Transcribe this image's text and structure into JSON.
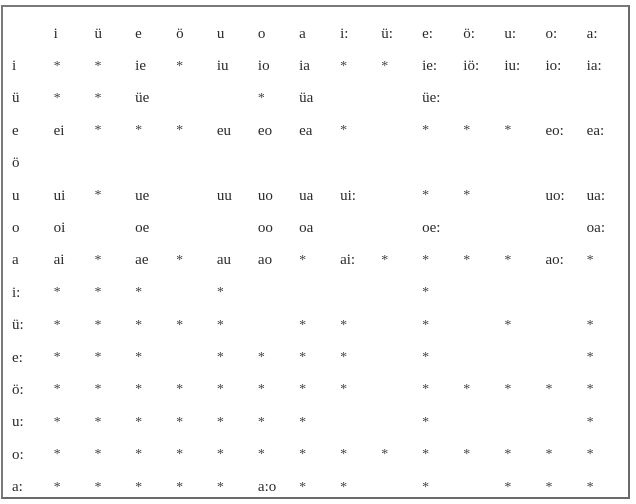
{
  "table": {
    "header": [
      "",
      "i",
      "ü",
      "e",
      "ö",
      "u",
      "o",
      "a",
      "i:",
      "ü:",
      "e:",
      "ö:",
      "u:",
      "o:",
      "a:"
    ],
    "rows": [
      {
        "label": "i",
        "cells": [
          "*",
          "*",
          "ie",
          "*",
          "iu",
          "io",
          "ia",
          "*",
          "*",
          "ie:",
          "iö:",
          "iu:",
          "io:",
          "ia:"
        ]
      },
      {
        "label": "ü",
        "cells": [
          "*",
          "*",
          "üe",
          "",
          "",
          "*",
          "üa",
          "",
          "",
          "üe:",
          "",
          "",
          "",
          ""
        ]
      },
      {
        "label": "e",
        "cells": [
          "ei",
          "*",
          "*",
          "*",
          "eu",
          "eo",
          "ea",
          "*",
          "",
          "*",
          "*",
          "*",
          "eo:",
          "ea:"
        ]
      },
      {
        "label": "ö",
        "cells": [
          "",
          "",
          "",
          "",
          "",
          "",
          "",
          "",
          "",
          "",
          "",
          "",
          "",
          ""
        ]
      },
      {
        "label": "u",
        "cells": [
          "ui",
          "*",
          "ue",
          "",
          "uu",
          "uo",
          "ua",
          "ui:",
          "",
          "*",
          "*",
          "",
          "uo:",
          "ua:"
        ]
      },
      {
        "label": "o",
        "cells": [
          "oi",
          "",
          "oe",
          "",
          "",
          "oo",
          "oa",
          "",
          "",
          "oe:",
          "",
          "",
          "",
          "oa:"
        ]
      },
      {
        "label": "a",
        "cells": [
          "ai",
          "*",
          "ae",
          "*",
          "au",
          "ao",
          "*",
          "ai:",
          "*",
          "*",
          "*",
          "*",
          "ao:",
          "*"
        ]
      },
      {
        "label": "i:",
        "cells": [
          "*",
          "*",
          "*",
          "",
          "*",
          "",
          "",
          "",
          "",
          "*",
          "",
          "",
          "",
          ""
        ]
      },
      {
        "label": "ü:",
        "cells": [
          "*",
          "*",
          "*",
          "*",
          "*",
          "",
          "*",
          "*",
          "",
          "*",
          "",
          "*",
          "",
          "*"
        ]
      },
      {
        "label": "e:",
        "cells": [
          "*",
          "*",
          "*",
          "",
          "*",
          "*",
          "*",
          "*",
          "",
          "*",
          "",
          "",
          "",
          "*"
        ]
      },
      {
        "label": "ö:",
        "cells": [
          "*",
          "*",
          "*",
          "*",
          "*",
          "*",
          "*",
          "*",
          "",
          "*",
          "*",
          "*",
          "*",
          "*"
        ]
      },
      {
        "label": "u:",
        "cells": [
          "*",
          "*",
          "*",
          "*",
          "*",
          "*",
          "*",
          "",
          "",
          "*",
          "",
          "",
          "",
          "*"
        ]
      },
      {
        "label": "o:",
        "cells": [
          "*",
          "*",
          "*",
          "*",
          "*",
          "*",
          "*",
          "*",
          "*",
          "*",
          "*",
          "*",
          "*",
          "*"
        ]
      },
      {
        "label": "a:",
        "cells": [
          "*",
          "*",
          "*",
          "*",
          "*",
          "a:o",
          "*",
          "*",
          "",
          "*",
          "",
          "*",
          "*",
          "*"
        ]
      }
    ]
  }
}
